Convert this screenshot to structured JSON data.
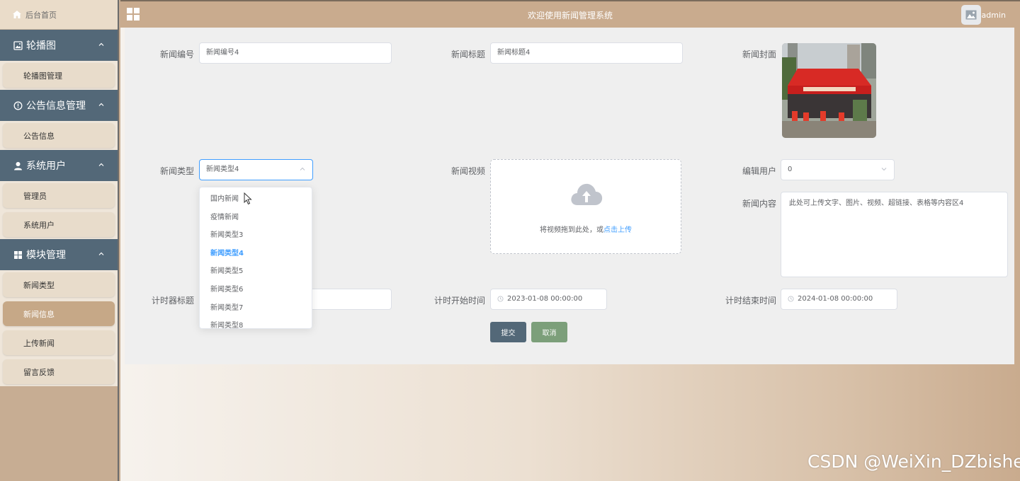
{
  "sidebar": {
    "home": "后台首页",
    "groups": [
      {
        "title": "轮播图",
        "icon": "image-icon",
        "items": [
          {
            "label": "轮播图管理"
          }
        ]
      },
      {
        "title": "公告信息管理",
        "icon": "info-circle-icon",
        "items": [
          {
            "label": "公告信息"
          }
        ]
      },
      {
        "title": "系统用户",
        "icon": "user-icon",
        "items": [
          {
            "label": "管理员"
          },
          {
            "label": "系统用户"
          }
        ]
      },
      {
        "title": "模块管理",
        "icon": "grid-icon",
        "items": [
          {
            "label": "新闻类型"
          },
          {
            "label": "新闻信息",
            "active": true
          },
          {
            "label": "上传新闻"
          },
          {
            "label": "留言反馈"
          }
        ]
      }
    ]
  },
  "header": {
    "title": "欢迎使用新闻管理系统",
    "user": "admin"
  },
  "form": {
    "news_no_label": "新闻编号",
    "news_no_value": "新闻编号4",
    "news_title_label": "新闻标题",
    "news_title_value": "新闻标题4",
    "cover_label": "新闻封面",
    "type_label": "新闻类型",
    "type_value": "新闻类型4",
    "video_label": "新闻视频",
    "video_hint": "将视频拖到此处，或",
    "video_link": "点击上传",
    "edit_user_label": "编辑用户",
    "edit_user_value": "0",
    "content_label": "新闻内容",
    "content_value": "此处可上传文字、图片、视频、超链接、表格等内容区4",
    "timer_title_label": "计时器标题",
    "timer_start_label": "计时开始时间",
    "timer_start_value": "2023-01-08 00:00:00",
    "timer_end_label": "计时结束时间",
    "timer_end_value": "2024-01-08 00:00:00",
    "submit_label": "提交",
    "cancel_label": "取消"
  },
  "dropdown": {
    "options": [
      "国内新闻",
      "疫情新闻",
      "新闻类型3",
      "新闻类型4",
      "新闻类型5",
      "新闻类型6",
      "新闻类型7",
      "新闻类型8"
    ],
    "selected": "新闻类型4"
  },
  "watermark": "CSDN @WeiXin_DZbishe",
  "colors": {
    "sidebar_group": "#536878",
    "accent": "#409eff",
    "submit": "#536878",
    "cancel": "#7c9f7a"
  }
}
